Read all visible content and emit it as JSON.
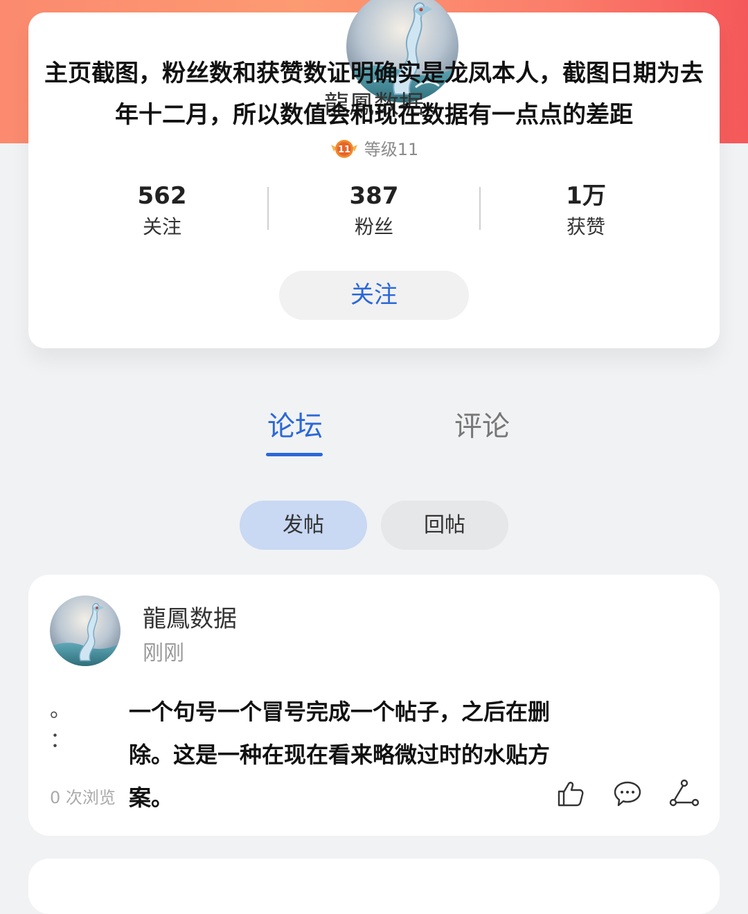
{
  "profile": {
    "name": "龍鳳数据",
    "level_label": "等级11",
    "level_badge_number": "11",
    "overlay_caption": "主页截图，粉丝数和获赞数证明确实是龙凤本人，截图日期为去年十二月，所以数值会和现在数据有一点点的差距",
    "stats": [
      {
        "value": "562",
        "label": "关注"
      },
      {
        "value": "387",
        "label": "粉丝"
      },
      {
        "value": "1万",
        "label": "获赞"
      }
    ],
    "follow_label": "关注"
  },
  "tabs": [
    {
      "label": "论坛",
      "active": true
    },
    {
      "label": "评论",
      "active": false
    }
  ],
  "subtabs": [
    {
      "label": "发帖",
      "active": true
    },
    {
      "label": "回帖",
      "active": false
    }
  ],
  "post": {
    "author": "龍鳳数据",
    "time": "刚刚",
    "marks": [
      "。",
      "："
    ],
    "body": "一个句号一个冒号完成一个帖子，之后在删除。这是一种在现在看来略微过时的水贴方案。",
    "views": "0 次浏览"
  },
  "colors": {
    "accent": "#2b68d8",
    "hero_gradient_start": "#fb8a6e",
    "hero_gradient_end": "#f5585a",
    "page_bg": "#f1f2f4"
  },
  "icons": [
    "like-icon",
    "comment-icon",
    "share-icon",
    "level-badge-icon"
  ]
}
